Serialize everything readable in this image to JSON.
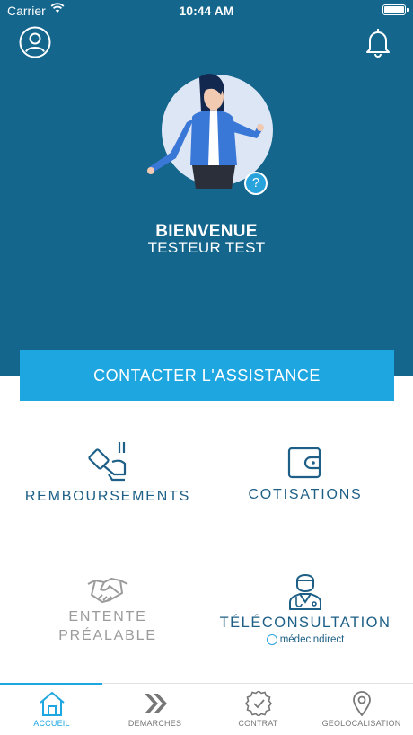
{
  "status_bar": {
    "carrier": "Carrier",
    "time": "10:44 AM"
  },
  "header": {
    "welcome_title": "BIENVENUE",
    "user_name": "TESTEUR TEST",
    "help_badge": "?"
  },
  "contact_button": {
    "label": "CONTACTER L'ASSISTANCE"
  },
  "tiles": {
    "remboursements": "REMBOURSEMENTS",
    "cotisations": "COTISATIONS",
    "entente_line1": "ENTENTE",
    "entente_line2": "PRÉALABLE",
    "teleconsultation": "TÉLÉCONSULTATION",
    "partner": "médecindirect"
  },
  "tabbar": {
    "items": [
      {
        "label": "ACCUEIL",
        "icon": "home-icon",
        "active": true
      },
      {
        "label": "DEMARCHES",
        "icon": "double-chevron-icon",
        "active": false
      },
      {
        "label": "CONTRAT",
        "icon": "badge-check-icon",
        "active": false
      },
      {
        "label": "GEOLOCALISATION",
        "icon": "map-pin-icon",
        "active": false
      }
    ]
  },
  "colors": {
    "header_bg": "#14668c",
    "accent": "#1ea6e0",
    "tile_text": "#1d5f86",
    "disabled_text": "#9b9b9b"
  }
}
